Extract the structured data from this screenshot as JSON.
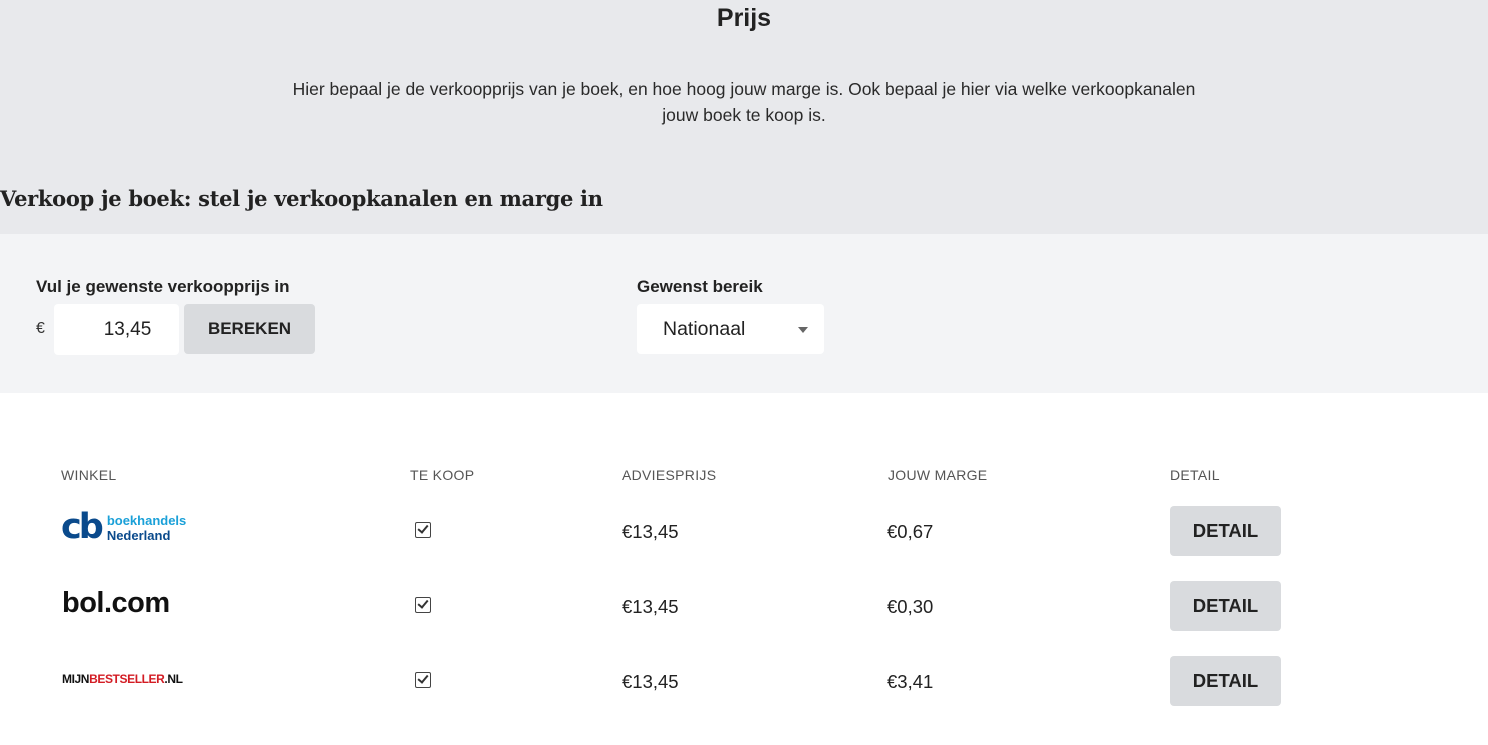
{
  "header": {
    "title": "Prijs",
    "intro_line1": "Hier bepaal je de verkoopprijs van je boek, en hoe hoog jouw marge is. Ook bepaal je hier via welke verkoopkanalen",
    "intro_line2": "jouw boek te koop is.",
    "section_title": "Verkoop je boek: stel je verkoopkanalen en marge in"
  },
  "price": {
    "label": "Vul je gewenste verkoopprijs in",
    "currency": "€",
    "value": "13,45",
    "calculate_label": "BEREKEN"
  },
  "reach": {
    "label": "Gewenst bereik",
    "selected": "Nationaal"
  },
  "table": {
    "headers": [
      "WINKEL",
      "TE KOOP",
      "ADVIESPRIJS",
      "JOUW MARGE",
      "DETAIL"
    ],
    "rows": [
      {
        "store": "boekhandels Nederland",
        "logo_mark": "cb",
        "logo_line1": "boekhandels",
        "logo_line2": "Nederland",
        "for_sale": true,
        "advice_price": "€13,45",
        "margin": "€0,67",
        "detail_label": "DETAIL"
      },
      {
        "store": "bol.com",
        "logo_text": "bol.com",
        "for_sale": true,
        "advice_price": "€13,45",
        "margin": "€0,30",
        "detail_label": "DETAIL"
      },
      {
        "store": "MIJNBESTSELLER.NL",
        "logo_part1": "MIJN",
        "logo_part2": "BESTSELLER",
        "logo_part3": ".NL",
        "for_sale": true,
        "advice_price": "€13,45",
        "margin": "€3,41",
        "detail_label": "DETAIL"
      }
    ]
  },
  "colors": {
    "header_bg": "#e8e9ec",
    "controls_bg": "#f3f4f6",
    "button_bg": "#d9dbde",
    "boekhandels_dark": "#0a4a8c",
    "boekhandels_light": "#1aa0d8",
    "mijnbestseller_red": "#d31c24"
  }
}
